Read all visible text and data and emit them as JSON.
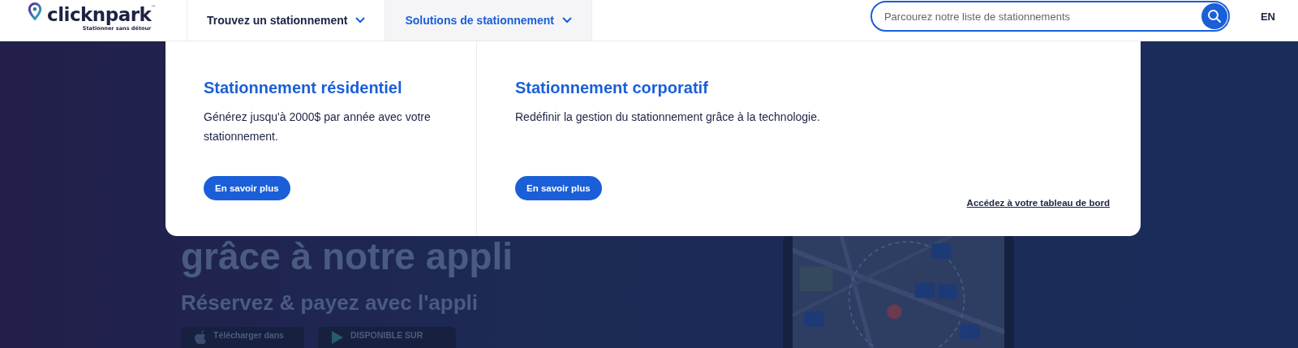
{
  "header": {
    "logo": {
      "name": "clicknpark",
      "trademark": "™",
      "tagline": "Stationner sans détour"
    },
    "nav": [
      {
        "label": "Trouvez un stationnement",
        "selected": false
      },
      {
        "label": "Solutions de stationnement",
        "selected": true
      }
    ],
    "search": {
      "placeholder": "Parcourez notre liste de stationnements"
    },
    "language": "EN"
  },
  "dropdown": {
    "columns": [
      {
        "title": "Stationnement résidentiel",
        "text": "Générez jusqu'à 2000$ par année avec votre stationnement.",
        "button": "En savoir plus"
      },
      {
        "title": "Stationnement corporatif",
        "text": "Redéfinir la gestion du stationnement grâce à la technologie.",
        "button": "En savoir plus"
      }
    ],
    "dashboard_link": "Accédez à votre tableau de bord"
  },
  "hero": {
    "headline": "grâce à notre appli",
    "subheading": "Réservez & payez avec l'appli",
    "store_buttons": [
      {
        "kind": "apple",
        "label": "Télécharger dans"
      },
      {
        "kind": "google",
        "label": "DISPONIBLE SUR"
      }
    ]
  }
}
